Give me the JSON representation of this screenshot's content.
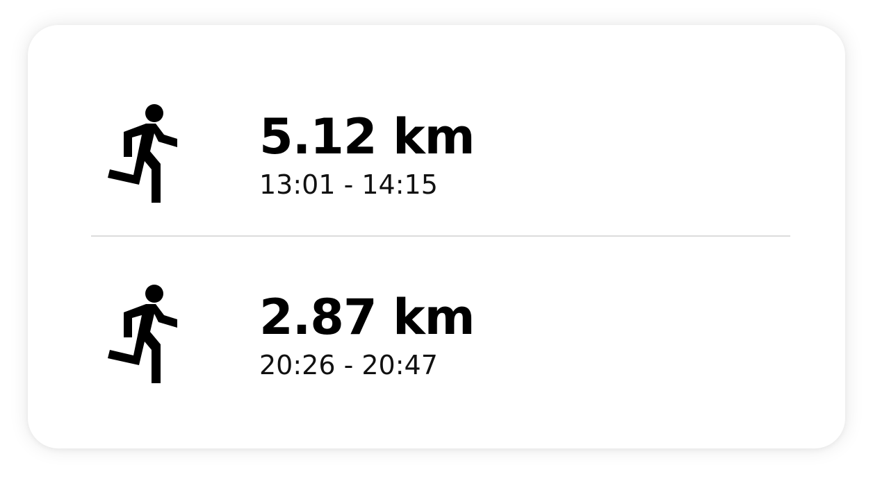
{
  "activities": [
    {
      "icon": "running-person-icon",
      "distance": "5.12 km",
      "time_range": "13:01 - 14:15"
    },
    {
      "icon": "running-person-icon",
      "distance": "2.87 km",
      "time_range": "20:26 - 20:47"
    }
  ],
  "colors": {
    "text": "#000000",
    "divider": "#dcdcdc",
    "background": "#ffffff"
  }
}
